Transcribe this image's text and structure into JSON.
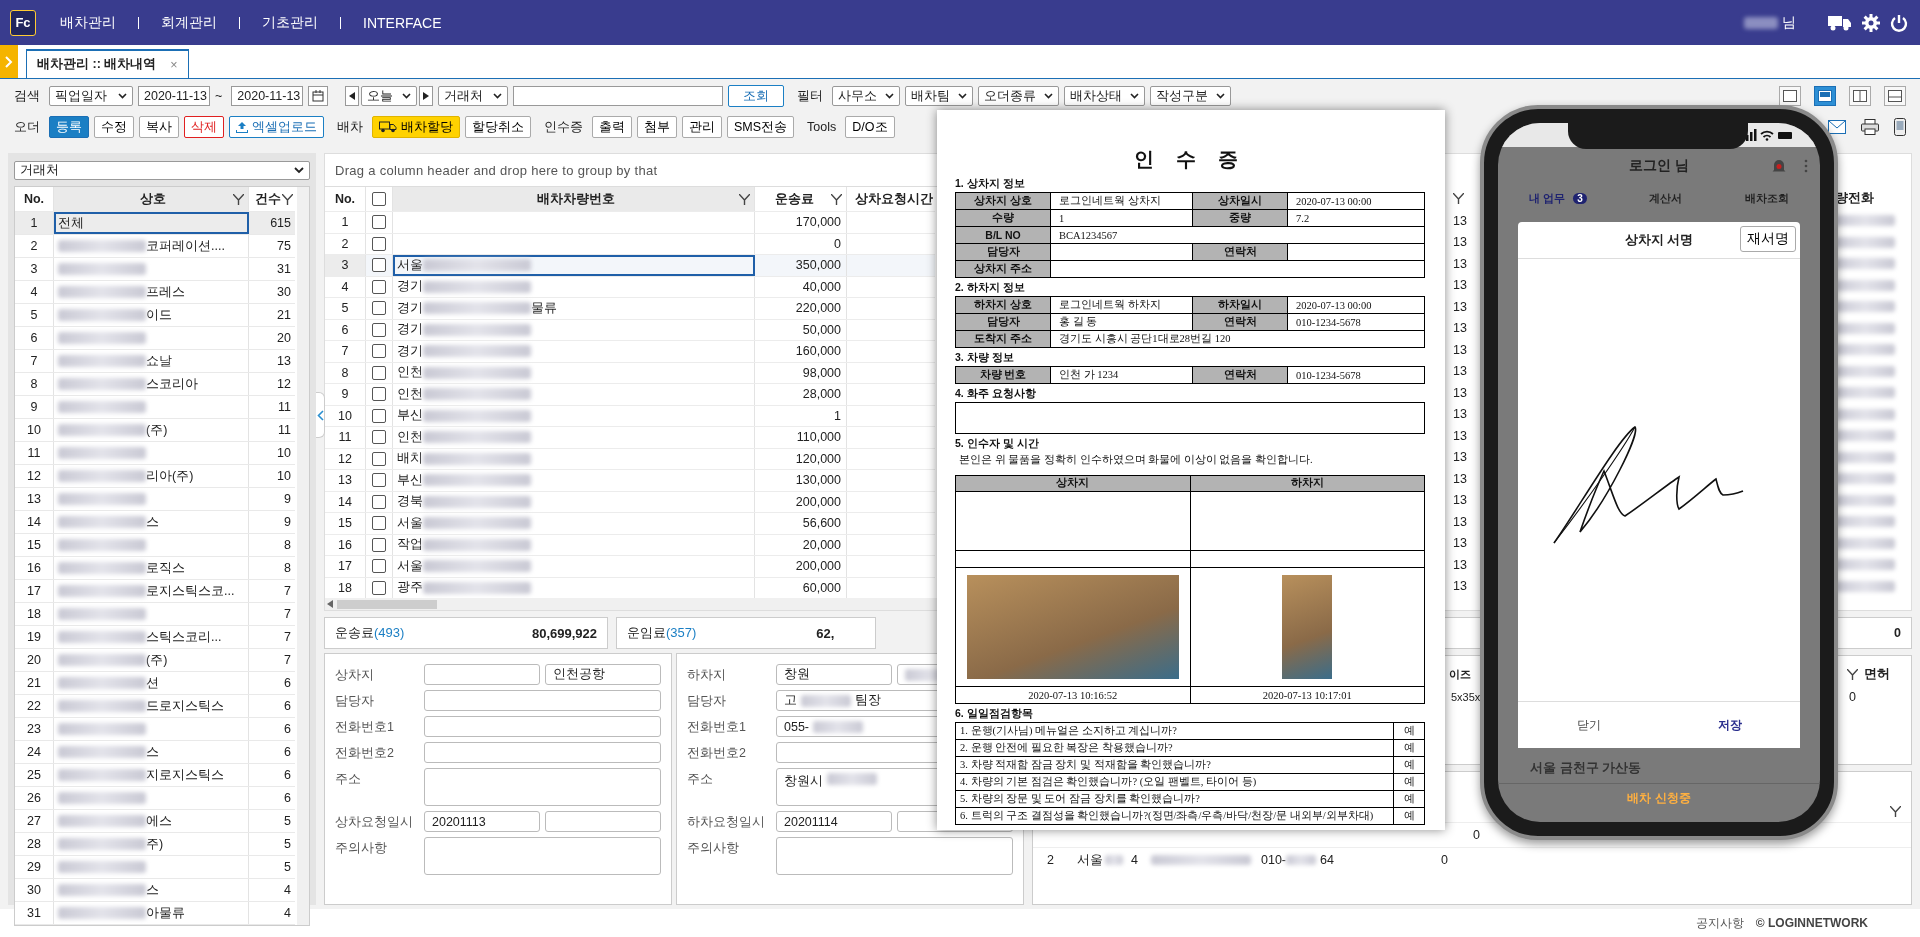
{
  "nav": {
    "logo": "Fc",
    "menus": [
      "배차관리",
      "회계관리",
      "기초관리",
      "INTERFACE"
    ],
    "user_suffix": "님"
  },
  "tabs": [
    {
      "label": "배차관리 :: 배차내역",
      "selected": true,
      "close": "×"
    }
  ],
  "search_bar": {
    "label": "검색",
    "date_type": "픽업일자",
    "date_from": "2020-11-13",
    "separator": "~",
    "date_to": "2020-11-13",
    "period": "오늘",
    "client_type": "거래처",
    "query_button": "조회",
    "filter_label": "필터",
    "filters": [
      "사무소",
      "배차팀",
      "오더종류",
      "배차상태",
      "작성구분"
    ]
  },
  "layout_options": [
    {
      "selected": false
    },
    {
      "selected": true
    },
    {
      "selected": false
    },
    {
      "selected": false
    }
  ],
  "action_bar": [
    {
      "label": "오더",
      "buttons": [
        {
          "label": "등록",
          "kind": "primary"
        },
        {
          "label": "수정",
          "kind": "plain"
        },
        {
          "label": "복사",
          "kind": "plain"
        },
        {
          "label": "삭제",
          "kind": "danger"
        },
        {
          "label": "엑셀업로드",
          "kind": "upload"
        }
      ]
    },
    {
      "label": "배차",
      "buttons": [
        {
          "label": "배차할당",
          "kind": "assign"
        },
        {
          "label": "할당취소",
          "kind": "plain"
        }
      ]
    },
    {
      "label": "인수증",
      "buttons": [
        {
          "label": "출력",
          "kind": "plain"
        },
        {
          "label": "첨부",
          "kind": "plain"
        },
        {
          "label": "관리",
          "kind": "plain"
        },
        {
          "label": "SMS전송",
          "kind": "plain"
        }
      ]
    },
    {
      "label": "Tools",
      "buttons": [
        {
          "label": "D/O조",
          "kind": "plain"
        }
      ]
    }
  ],
  "client_panel": {
    "select": "거래처",
    "columns": [
      "No.",
      "상호",
      "건수"
    ],
    "rows": [
      {
        "no": "1",
        "name": "전체",
        "count": "615",
        "masked": false,
        "selected": true
      },
      {
        "no": "2",
        "name": "코퍼레이션....",
        "count": "75",
        "masked": true,
        "selected": false
      },
      {
        "no": "3",
        "count": "31",
        "masked": true,
        "selected": false
      },
      {
        "no": "4",
        "name": "프레스",
        "count": "30",
        "masked": true,
        "selected": false
      },
      {
        "no": "5",
        "name": "이드",
        "count": "21",
        "masked": true,
        "selected": false
      },
      {
        "no": "6",
        "count": "20",
        "masked": true,
        "selected": false
      },
      {
        "no": "7",
        "name": "쇼날",
        "count": "13",
        "masked": true,
        "selected": false
      },
      {
        "no": "8",
        "name": "스코리아",
        "count": "12",
        "masked": true,
        "selected": false
      },
      {
        "no": "9",
        "count": "11",
        "masked": true,
        "selected": false
      },
      {
        "no": "10",
        "name": "(주)",
        "count": "11",
        "masked": true,
        "selected": false
      },
      {
        "no": "11",
        "count": "10",
        "masked": true,
        "selected": false
      },
      {
        "no": "12",
        "name": "리아(주)",
        "count": "10",
        "masked": true,
        "selected": false
      },
      {
        "no": "13",
        "count": "9",
        "masked": true,
        "selected": false
      },
      {
        "no": "14",
        "name": "스",
        "count": "9",
        "masked": true,
        "selected": false
      },
      {
        "no": "15",
        "count": "8",
        "masked": true,
        "selected": false
      },
      {
        "no": "16",
        "name": "로직스",
        "count": "8",
        "masked": true,
        "selected": false
      },
      {
        "no": "17",
        "name": "로지스틱스코...",
        "count": "7",
        "masked": true,
        "selected": false
      },
      {
        "no": "18",
        "count": "7",
        "masked": true,
        "selected": false
      },
      {
        "no": "19",
        "name": "스틱스코리...",
        "count": "7",
        "masked": true,
        "selected": false
      },
      {
        "no": "20",
        "name": "(주)",
        "count": "7",
        "masked": true,
        "selected": false
      },
      {
        "no": "21",
        "name": "션",
        "count": "6",
        "masked": true,
        "selected": false
      },
      {
        "no": "22",
        "name": "드로지스틱스",
        "count": "6",
        "masked": true,
        "selected": false
      },
      {
        "no": "23",
        "count": "6",
        "masked": true,
        "selected": false
      },
      {
        "no": "24",
        "name": "스",
        "count": "6",
        "masked": true,
        "selected": false
      },
      {
        "no": "25",
        "name": "지로지스틱스",
        "count": "6",
        "masked": true,
        "selected": false
      },
      {
        "no": "26",
        "count": "6",
        "masked": true,
        "selected": false
      },
      {
        "no": "27",
        "name": "에스",
        "count": "5",
        "masked": true,
        "selected": false
      },
      {
        "no": "28",
        "name": "주)",
        "count": "5",
        "masked": true,
        "selected": false
      },
      {
        "no": "29",
        "count": "5",
        "masked": true,
        "selected": false
      },
      {
        "no": "30",
        "name": "스",
        "count": "4",
        "masked": true,
        "selected": false
      },
      {
        "no": "31",
        "name": "아물류",
        "count": "4",
        "masked": true,
        "selected": false
      }
    ]
  },
  "dispatch_grid": {
    "select_all_checked": false,
    "group_hint": "Drag a column header and drop here to group by that",
    "columns": [
      "No.",
      "배차차량번호",
      "운송료",
      "상차요청시간"
    ],
    "rows": [
      {
        "no": "1",
        "fee": "170,000",
        "masked": false,
        "checked": false,
        "selected": false
      },
      {
        "no": "2",
        "fee": "0",
        "masked": false,
        "checked": false,
        "selected": false
      },
      {
        "no": "3",
        "vehicle": "서울",
        "fee": "350,000",
        "masked": true,
        "checked": false,
        "selected": true
      },
      {
        "no": "4",
        "vehicle": "경기",
        "fee": "40,000",
        "masked": true,
        "checked": false,
        "selected": false
      },
      {
        "no": "5",
        "vehicle": "경기",
        "vehicle_suffix": "물류",
        "fee": "220,000",
        "masked": true,
        "checked": false,
        "selected": false
      },
      {
        "no": "6",
        "vehicle": "경기",
        "fee": "50,000",
        "masked": true,
        "checked": false,
        "selected": false
      },
      {
        "no": "7",
        "vehicle": "경기",
        "fee": "160,000",
        "masked": true,
        "checked": false,
        "selected": false
      },
      {
        "no": "8",
        "vehicle": "인천",
        "fee": "98,000",
        "masked": true,
        "checked": false,
        "selected": false
      },
      {
        "no": "9",
        "vehicle": "인천",
        "fee": "28,000",
        "masked": true,
        "checked": false,
        "selected": false
      },
      {
        "no": "10",
        "vehicle": "부신",
        "fee": "1",
        "masked": true,
        "checked": false,
        "selected": false
      },
      {
        "no": "11",
        "vehicle": "인천",
        "fee": "110,000",
        "masked": true,
        "checked": false,
        "selected": false
      },
      {
        "no": "12",
        "vehicle": "배치",
        "fee": "120,000",
        "masked": true,
        "checked": false,
        "selected": false
      },
      {
        "no": "13",
        "vehicle": "부신",
        "fee": "130,000",
        "masked": true,
        "checked": false,
        "selected": false
      },
      {
        "no": "14",
        "vehicle": "경북",
        "fee": "200,000",
        "masked": true,
        "checked": false,
        "selected": false
      },
      {
        "no": "15",
        "vehicle": "서울",
        "fee": "56,600",
        "masked": true,
        "checked": false,
        "selected": false
      },
      {
        "no": "16",
        "vehicle": "작업",
        "fee": "20,000",
        "masked": true,
        "checked": false,
        "selected": false
      },
      {
        "no": "17",
        "vehicle": "서울",
        "fee": "200,000",
        "masked": true,
        "checked": false,
        "selected": false
      },
      {
        "no": "18",
        "vehicle": "광주",
        "fee": "60,000",
        "masked": true,
        "checked": false,
        "selected": false
      }
    ]
  },
  "summaries": [
    {
      "label": "운송료",
      "count": "(493)",
      "amount": "80,699,922"
    },
    {
      "label": "운임료",
      "count": "(357)",
      "amount": "62,"
    }
  ],
  "pickup_form": [
    {
      "label": "상차지",
      "kind": "pair",
      "value2": "인천공항",
      "masked": false
    },
    {
      "label": "담당자",
      "kind": "single",
      "masked": false
    },
    {
      "label": "전화번호1",
      "kind": "single",
      "masked": false
    },
    {
      "label": "전화번호2",
      "kind": "single",
      "masked": false
    },
    {
      "label": "주소",
      "kind": "area",
      "masked": false
    },
    {
      "label": "상차요청일시",
      "kind": "pair",
      "value": "20201113",
      "masked": false
    },
    {
      "label": "주의사항",
      "kind": "area",
      "masked": false
    }
  ],
  "dropoff_form": [
    {
      "label": "하차지",
      "kind": "pair",
      "value": "창원",
      "masked": true
    },
    {
      "label": "담당자",
      "kind": "single",
      "value": "고",
      "suffix": "팀장",
      "masked": true
    },
    {
      "label": "전화번호1",
      "kind": "single",
      "value": "055-",
      "masked": true
    },
    {
      "label": "전화번호2",
      "kind": "single",
      "masked": false
    },
    {
      "label": "주소",
      "kind": "area",
      "value": "창원시",
      "masked": true
    },
    {
      "label": "하차요청일시",
      "kind": "pair",
      "value": "20201114",
      "masked": false
    },
    {
      "label": "주의사항",
      "kind": "area",
      "masked": false
    }
  ],
  "side_grid": {
    "date_cells": [
      "13",
      "13",
      "13",
      "13",
      "13",
      "13",
      "13",
      "13",
      "13",
      "13",
      "13",
      "13",
      "13",
      "13",
      "13",
      "13",
      "13",
      "13"
    ],
    "phone_header": "량전화",
    "summary_value": "0",
    "size_header": "이즈",
    "size_value": "5x35x",
    "license_header": "면허",
    "license_value": "0",
    "lower_values": [
      "0",
      "0"
    ],
    "lower_row": [
      "2",
      "서울",
      "4",
      "010-",
      "64"
    ]
  },
  "receipt": {
    "title": "인 수 증",
    "sections": [
      {
        "heading": "1. 상차지 정보",
        "rows": [
          [
            {
              "kind": "head",
              "text": "상차지 상호"
            },
            {
              "kind": "value",
              "text": "로그인네트웍 상차지"
            },
            {
              "kind": "head",
              "text": "상차일시"
            },
            {
              "kind": "value",
              "text": "2020-07-13 00:00"
            }
          ],
          [
            {
              "kind": "head",
              "text": "수량"
            },
            {
              "kind": "value",
              "text": "1"
            },
            {
              "kind": "head",
              "text": "중량"
            },
            {
              "kind": "value",
              "text": "7.2"
            }
          ],
          [
            {
              "kind": "head",
              "text": "B/L NO"
            },
            {
              "kind": "wide",
              "text": "BCA1234567"
            }
          ],
          [
            {
              "kind": "head",
              "text": "담당자"
            },
            {
              "kind": "value"
            },
            {
              "kind": "head",
              "text": "연락처"
            },
            {
              "kind": "value"
            }
          ],
          [
            {
              "kind": "head",
              "text": "상차지 주소"
            },
            {
              "kind": "wide"
            }
          ]
        ]
      },
      {
        "heading": "2. 하차지 정보",
        "rows": [
          [
            {
              "kind": "head",
              "text": "하차지 상호"
            },
            {
              "kind": "value",
              "text": "로그인네트웍 하차지"
            },
            {
              "kind": "head",
              "text": "하차일시"
            },
            {
              "kind": "value",
              "text": "2020-07-13 00:00"
            }
          ],
          [
            {
              "kind": "head",
              "text": "담당자"
            },
            {
              "kind": "value",
              "text": "홍 길 동"
            },
            {
              "kind": "head",
              "text": "연락처"
            },
            {
              "kind": "value",
              "text": "010-1234-5678"
            }
          ],
          [
            {
              "kind": "head",
              "text": "도착지 주소"
            },
            {
              "kind": "wide",
              "text": "경기도 시흥시 공단1대로28번길 120"
            }
          ]
        ]
      },
      {
        "heading": "3. 차량 정보",
        "rows": [
          [
            {
              "kind": "head",
              "text": "차량 번호"
            },
            {
              "kind": "value",
              "text": "인천 가 1234"
            },
            {
              "kind": "head",
              "text": "연락처"
            },
            {
              "kind": "value",
              "text": "010-1234-5678"
            }
          ]
        ]
      }
    ],
    "request_heading": "4. 화주 요청사항",
    "receiver_heading": "5. 인수자 및 시간",
    "receiver_note": "본인은 위 물품을 정확히 인수하였으며 화물에 이상이 없음을 확인합니다.",
    "receiver_columns": [
      {
        "label": "상차지",
        "kind": "wide",
        "time": "2020-07-13 10:16:52"
      },
      {
        "label": "하차지",
        "kind": "narrow",
        "time": "2020-07-13 10:17:01"
      }
    ],
    "check_heading": "6. 일일점검항목",
    "checks": [
      {
        "text": "1. 운행(기사님) 메뉴얼은 소지하고 계십니까?",
        "answer": "예"
      },
      {
        "text": "2. 운행 안전에 필요한 복장은 착용했습니까?",
        "answer": "예"
      },
      {
        "text": "3. 차량 적재함 잠금 장치 및 적재함을 확인했습니까?",
        "answer": "예"
      },
      {
        "text": "4. 차량의 기본 점검은 확인했습니까? (오일 팬벨트, 타이어 등)",
        "answer": "예"
      },
      {
        "text": "5. 차량의 장문 및 도어 잠금 장치를 확인했습니까?",
        "answer": "예"
      },
      {
        "text": "6. 트럭의 구조 결점성을 확인했습니까?(정면/좌측/우측/바닥/천장/문 내외부/외부차대)",
        "answer": "예"
      }
    ]
  },
  "phone": {
    "title": "로그인 님",
    "tabs": [
      {
        "label": "내 업무",
        "badge": "3",
        "selected": true
      },
      {
        "label": "계산서",
        "selected": false
      },
      {
        "label": "배차조회",
        "selected": false
      }
    ],
    "dialog": {
      "title": "상차지 서명",
      "resign": "재서명",
      "cancel": "닫기",
      "save": "저장"
    },
    "address": "서울 금천구 가산동",
    "status": "배차 신청중"
  },
  "footer": {
    "notice": "공지사항",
    "copyright": "© LOGINNETWORK"
  }
}
